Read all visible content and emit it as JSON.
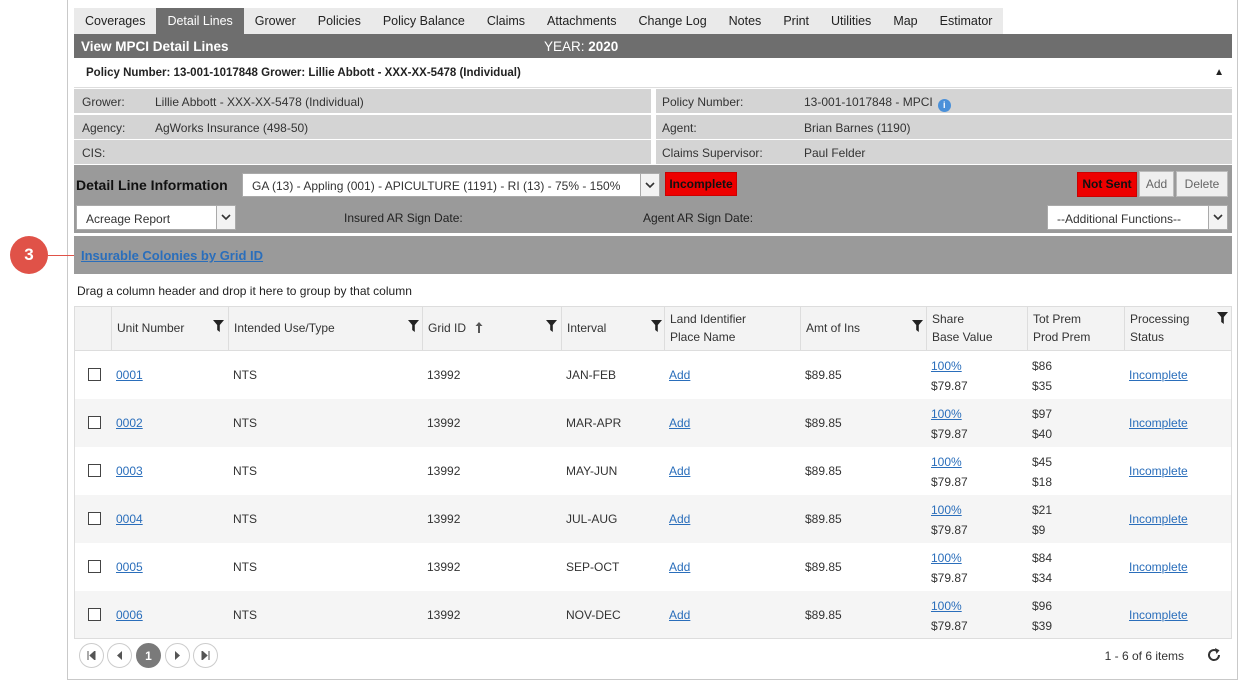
{
  "annotation": {
    "number": "3"
  },
  "tabs": [
    "Coverages",
    "Detail Lines",
    "Grower",
    "Policies",
    "Policy Balance",
    "Claims",
    "Attachments",
    "Change Log",
    "Notes",
    "Print",
    "Utilities",
    "Map",
    "Estimator"
  ],
  "active_tab": "Detail Lines",
  "header": {
    "title": "View MPCI Detail Lines",
    "year_label": "YEAR:",
    "year": "2020",
    "policy_summary": "Policy Number: 13-001-1017848 Grower: Lillie Abbott - XXX-XX-5478 (Individual)"
  },
  "info": {
    "grower_label": "Grower:",
    "grower": "Lillie Abbott - XXX-XX-5478 (Individual)",
    "policy_number_label": "Policy Number:",
    "policy_number": "13-001-1017848 - MPCI",
    "agency_label": "Agency:",
    "agency": "AgWorks Insurance (498-50)",
    "agent_label": "Agent:",
    "agent": "Brian Barnes (1190)",
    "cis_label": "CIS:",
    "cis": "",
    "claims_supervisor_label": "Claims Supervisor:",
    "claims_supervisor": "Paul Felder"
  },
  "detail": {
    "title": "Detail Line Information",
    "line_select": "GA (13) - Appling (001) - APICULTURE (1191) - RI (13) - 75% - 150%",
    "status": "Incomplete",
    "not_sent": "Not Sent",
    "add": "Add",
    "delete": "Delete",
    "report_select": "Acreage Report",
    "insured_ar_label": "Insured AR Sign Date:",
    "agent_ar_label": "Agent AR Sign Date:",
    "additional_functions": "--Additional Functions--"
  },
  "grid": {
    "title": "Insurable Colonies by Grid ID",
    "group_hint": "Drag a column header and drop it here to group by that column",
    "headers": {
      "unit": "Unit Number",
      "use": "Intended Use/Type",
      "grid_id": "Grid ID",
      "interval": "Interval",
      "land_1": "Land Identifier",
      "land_2": "Place Name",
      "amt": "Amt of Ins",
      "share_1": "Share",
      "share_2": "Base Value",
      "prem_1": "Tot Prem",
      "prem_2": "Prod Prem",
      "status_1": "Processing",
      "status_2": "Status"
    },
    "rows": [
      {
        "unit": "0001",
        "use": "NTS",
        "grid_id": "13992",
        "interval": "JAN-FEB",
        "land": "Add",
        "amt": "$89.85",
        "share": "100%",
        "base": "$79.87",
        "tot": "$86",
        "prod": "$35",
        "status": "Incomplete"
      },
      {
        "unit": "0002",
        "use": "NTS",
        "grid_id": "13992",
        "interval": "MAR-APR",
        "land": "Add",
        "amt": "$89.85",
        "share": "100%",
        "base": "$79.87",
        "tot": "$97",
        "prod": "$40",
        "status": "Incomplete"
      },
      {
        "unit": "0003",
        "use": "NTS",
        "grid_id": "13992",
        "interval": "MAY-JUN",
        "land": "Add",
        "amt": "$89.85",
        "share": "100%",
        "base": "$79.87",
        "tot": "$45",
        "prod": "$18",
        "status": "Incomplete"
      },
      {
        "unit": "0004",
        "use": "NTS",
        "grid_id": "13992",
        "interval": "JUL-AUG",
        "land": "Add",
        "amt": "$89.85",
        "share": "100%",
        "base": "$79.87",
        "tot": "$21",
        "prod": "$9",
        "status": "Incomplete"
      },
      {
        "unit": "0005",
        "use": "NTS",
        "grid_id": "13992",
        "interval": "SEP-OCT",
        "land": "Add",
        "amt": "$89.85",
        "share": "100%",
        "base": "$79.87",
        "tot": "$84",
        "prod": "$34",
        "status": "Incomplete"
      },
      {
        "unit": "0006",
        "use": "NTS",
        "grid_id": "13992",
        "interval": "NOV-DEC",
        "land": "Add",
        "amt": "$89.85",
        "share": "100%",
        "base": "$79.87",
        "tot": "$96",
        "prod": "$39",
        "status": "Incomplete"
      }
    ],
    "pager": {
      "current_page": "1",
      "summary": "1 - 6 of 6 items"
    }
  },
  "icons": [
    "first-page-icon",
    "prev-page-icon",
    "next-page-icon",
    "last-page-icon",
    "refresh-icon",
    "filter-icon",
    "sort-ascending-icon",
    "chevron-down-icon",
    "collapse-caret-icon",
    "info-icon"
  ],
  "colors": {
    "header_bg": "#6e6e6e",
    "status_red": "#ee0000",
    "link": "#2a6ebb",
    "annotation": "#e05248"
  }
}
